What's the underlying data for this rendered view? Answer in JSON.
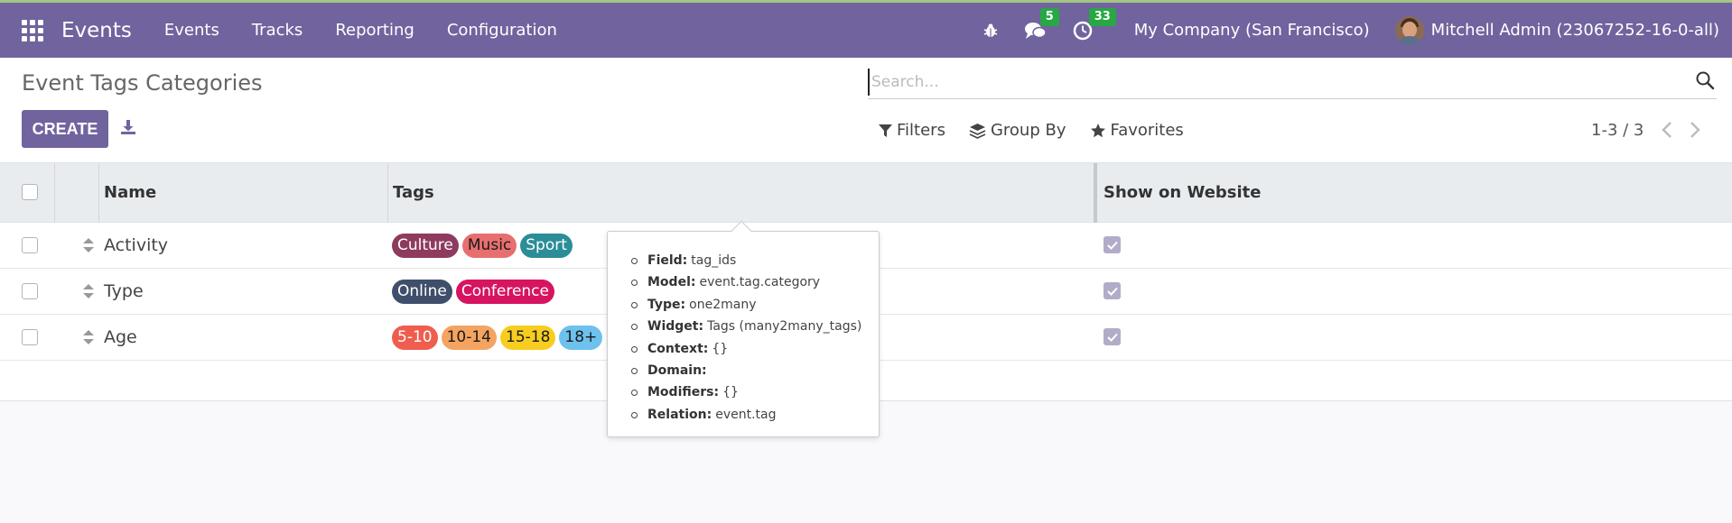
{
  "navbar": {
    "app_name": "Events",
    "menu": [
      "Events",
      "Tracks",
      "Reporting",
      "Configuration"
    ],
    "messages_count": "5",
    "activities_count": "33",
    "company": "My Company (San Francisco)",
    "user": "Mitchell Admin (23067252-16-0-all)"
  },
  "control_panel": {
    "title": "Event Tags Categories",
    "create_label": "CREATE",
    "search_placeholder": "Search...",
    "filters_label": "Filters",
    "group_by_label": "Group By",
    "favorites_label": "Favorites",
    "pager": "1-3 / 3"
  },
  "table": {
    "headers": {
      "name": "Name",
      "tags": "Tags",
      "show_on_website": "Show on Website"
    },
    "rows": [
      {
        "name": "Activity",
        "tags": [
          {
            "label": "Culture",
            "color": "#8e3b5f"
          },
          {
            "label": "Music",
            "color": "#e86f6f"
          },
          {
            "label": "Sport",
            "color": "#2a8d98"
          }
        ],
        "show_on_website": true
      },
      {
        "name": "Type",
        "tags": [
          {
            "label": "Online",
            "color": "#3f4f6b"
          },
          {
            "label": "Conference",
            "color": "#d6145f"
          }
        ],
        "show_on_website": true
      },
      {
        "name": "Age",
        "tags": [
          {
            "label": "5-10",
            "color": "#ef5d4e"
          },
          {
            "label": "10-14",
            "color": "#f4a460"
          },
          {
            "label": "15-18",
            "color": "#f7cd1f"
          },
          {
            "label": "18+",
            "color": "#6cc1ed"
          }
        ],
        "show_on_website": true
      }
    ]
  },
  "tooltip": {
    "items": [
      {
        "key": "Field:",
        "value": "tag_ids"
      },
      {
        "key": "Model:",
        "value": "event.tag.category"
      },
      {
        "key": "Type:",
        "value": "one2many"
      },
      {
        "key": "Widget:",
        "value": "Tags (many2many_tags)"
      },
      {
        "key": "Context:",
        "value": "{}"
      },
      {
        "key": "Domain:",
        "value": ""
      },
      {
        "key": "Modifiers:",
        "value": "{}"
      },
      {
        "key": "Relation:",
        "value": "event.tag"
      }
    ]
  },
  "colors": {
    "brand": "#71639e",
    "badge": "#28a745",
    "checked": "#b2acc9"
  }
}
